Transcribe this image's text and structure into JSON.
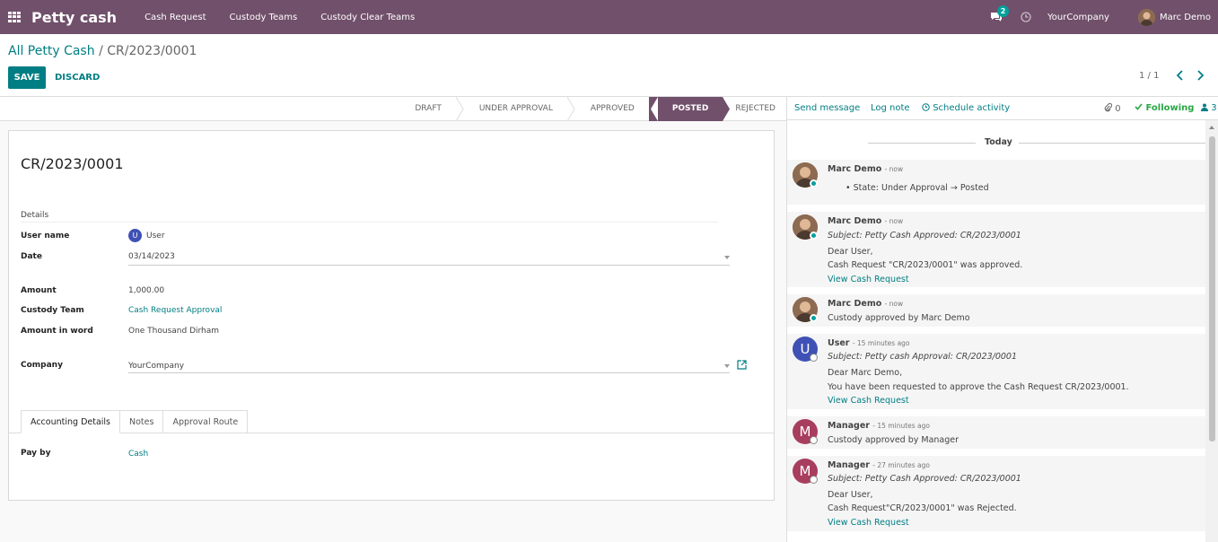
{
  "navbar": {
    "brand": "Petty cash",
    "menu": [
      "Cash Request",
      "Custody Teams",
      "Custody Clear Teams"
    ],
    "chat_badge": "2",
    "company": "YourCompany",
    "user": "Marc Demo"
  },
  "control": {
    "breadcrumb_parent": "All Petty Cash",
    "breadcrumb_sep": "/",
    "breadcrumb_current": "CR/2023/0001",
    "save_label": "SAVE",
    "discard_label": "DISCARD",
    "pager": "1 / 1"
  },
  "statusbar": {
    "stages": [
      "DRAFT",
      "UNDER APPROVAL",
      "APPROVED",
      "POSTED",
      "REJECTED"
    ],
    "active": "POSTED"
  },
  "form": {
    "title": "CR/2023/0001",
    "group_title": "Details",
    "user_name_label": "User name",
    "user_initial": "U",
    "user_name": "User",
    "date_label": "Date",
    "date": "03/14/2023",
    "amount_label": "Amount",
    "amount": "1,000.00",
    "team_label": "Custody Team",
    "team": "Cash Request Approval",
    "word_label": "Amount in word",
    "word": "One Thousand Dirham",
    "company_label": "Company",
    "company": "YourCompany",
    "tabs": [
      "Accounting Details",
      "Notes",
      "Approval Route"
    ],
    "pay_by_label": "Pay by",
    "pay_by": "Cash"
  },
  "chatter": {
    "send_message": "Send message",
    "log_note": "Log note",
    "schedule": "Schedule activity",
    "attachments": "0",
    "following": "Following",
    "followers": "3",
    "today": "Today",
    "messages": [
      {
        "author": "Marc Demo",
        "when": "- now",
        "lines": [
          "• State: Under Approval → Posted"
        ]
      },
      {
        "author": "Marc Demo",
        "when": "- now",
        "subject": "Subject: Petty Cash Approved: CR/2023/0001",
        "lines": [
          "Dear User,",
          "Cash Request \"CR/2023/0001\" was approved."
        ],
        "link": "View Cash Request"
      },
      {
        "author": "Marc Demo",
        "when": "- now",
        "lines": [
          "Custody approved by Marc Demo"
        ]
      },
      {
        "author": "User",
        "initial": "U",
        "when": "- 15 minutes ago",
        "subject": "Subject: Petty cash Approval: CR/2023/0001",
        "lines": [
          "Dear Marc Demo,",
          "You have been requested to approve the Cash Request CR/2023/0001."
        ],
        "link": "View Cash Request"
      },
      {
        "author": "Manager",
        "initial": "M",
        "when": "- 15 minutes ago",
        "lines": [
          "Custody approved by Manager"
        ]
      },
      {
        "author": "Manager",
        "initial": "M",
        "when": "- 27 minutes ago",
        "subject": "Subject: Petty Cash Approved: CR/2023/0001",
        "lines": [
          "Dear User,",
          "Cash Request\"CR/2023/0001\" was Rejected."
        ],
        "link": "View Cash Request"
      }
    ]
  },
  "colors": {
    "brand": "#71506b",
    "accent": "#017e84",
    "user_avatar": "#3f51b5",
    "manager_avatar": "#a83e5e"
  }
}
